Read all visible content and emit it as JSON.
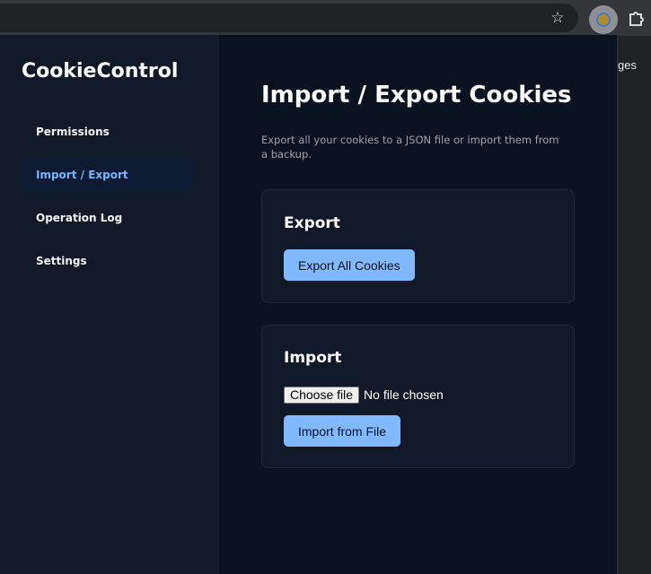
{
  "browser": {
    "toolbar_icons": [
      "star-icon",
      "extension-icon",
      "puzzle-icon"
    ],
    "background_page_text": "ges"
  },
  "app": {
    "brand": "CookieControl",
    "accent_color": "#82b8ff",
    "sidebar": {
      "items": [
        {
          "label": "Permissions",
          "active": false
        },
        {
          "label": "Import / Export",
          "active": true
        },
        {
          "label": "Operation Log",
          "active": false
        },
        {
          "label": "Settings",
          "active": false
        }
      ]
    },
    "main": {
      "title": "Import / Export Cookies",
      "description": "Export all your cookies to a JSON file or import them from a backup.",
      "export": {
        "title": "Export",
        "button_label": "Export All Cookies"
      },
      "import": {
        "title": "Import",
        "file_button_label": "Choose file",
        "file_status": "No file chosen",
        "button_label": "Import from File"
      }
    }
  }
}
